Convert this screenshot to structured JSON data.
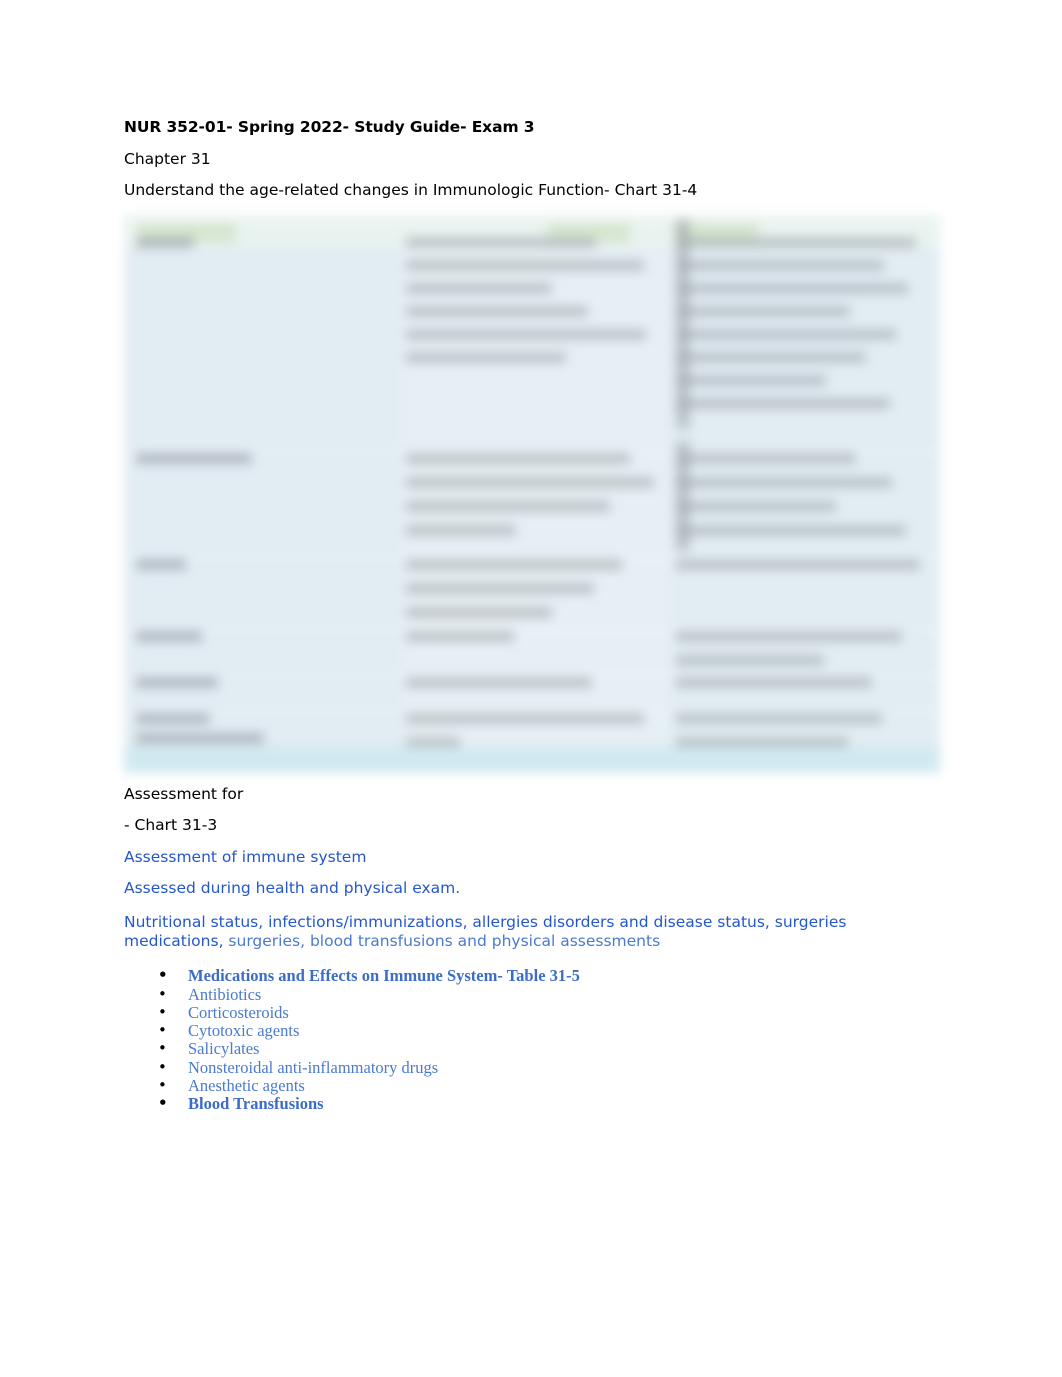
{
  "document": {
    "title": "NUR 352-01- Spring 2022- Study Guide- Exam 3",
    "chapter": "Chapter 31",
    "objective": "Understand the age-related changes in Immunologic Function- Chart 31-4",
    "assessment_label": "Assessment for",
    "assessment_chart_ref": " - Chart 31-3",
    "assessment_line_1": "Assessment of immune system",
    "assessment_line_2": "Assessed during health and physical exam.",
    "assessment_detail_strong": "Nutritional status, infections/immunizations, allergies disorders and disease status, surgeries medications,",
    "assessment_detail_light": " surgeries, blood transfusions and physical assessments"
  },
  "figure": {
    "name": "Chart 31-4 age-related changes in immunologic function table",
    "state": "blurred"
  },
  "medication_list": [
    {
      "label": "Medications and Effects on Immune System- Table 31-5",
      "bold": true
    },
    {
      "label": "Antibiotics",
      "bold": false
    },
    {
      "label": "Corticosteroids",
      "bold": false
    },
    {
      "label": "Cytotoxic agents",
      "bold": false
    },
    {
      "label": "Salicylates",
      "bold": false
    },
    {
      "label": "Nonsteroidal anti-inflammatory drugs",
      "bold": false
    },
    {
      "label": "Anesthetic agents",
      "bold": false
    },
    {
      "label": "Blood Transfusions",
      "bold": true
    }
  ],
  "colors": {
    "text": "#000000",
    "blue_strong": "#2457cc",
    "blue_mid": "#4a7ad0",
    "blue_bold": "#3c6dc6",
    "table_tint": "#e2edf4",
    "table_header_tint": "#cfe0c4",
    "table_footer_tint": "#cfe9f0"
  }
}
